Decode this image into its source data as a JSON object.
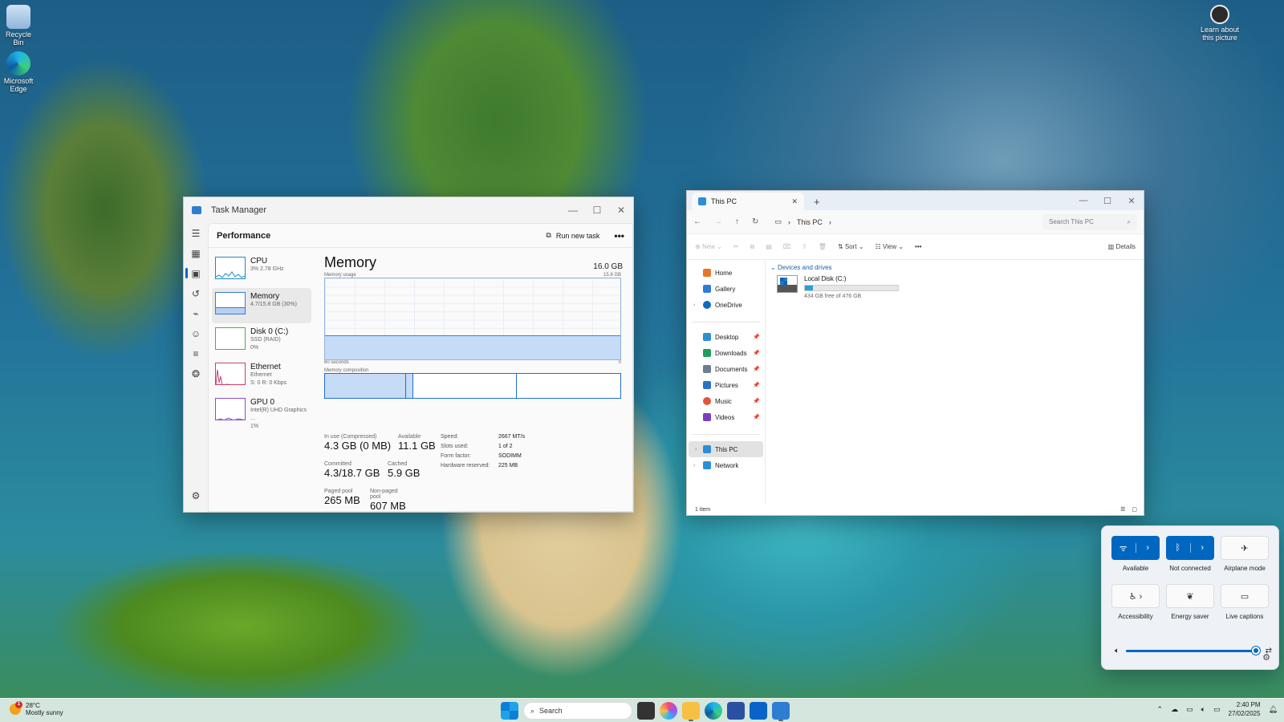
{
  "desktop": {
    "icons": [
      {
        "label": "Recycle Bin",
        "icon": "recycle-bin-icon"
      },
      {
        "label": "Microsoft Edge",
        "icon": "edge-icon"
      }
    ],
    "spotlight_label": "Learn about this picture"
  },
  "task_manager": {
    "title": "Task Manager",
    "window_controls": [
      "—",
      "☐",
      "✕"
    ],
    "page_title": "Performance",
    "run_new_task": "Run new task",
    "more": "•••",
    "rail_icons": [
      "menu-icon",
      "processes-icon",
      "performance-icon",
      "app-history-icon",
      "startup-icon",
      "users-icon",
      "details-icon",
      "services-icon"
    ],
    "resources": [
      {
        "name": "CPU",
        "sub1": "3% 2.78 GHz",
        "sub2": "",
        "sub3": "",
        "color": "#1c8cbc"
      },
      {
        "name": "Memory",
        "sub1": "4.7/15.8 GB (30%)",
        "sub2": "",
        "sub3": "",
        "color": "#7fa9e0"
      },
      {
        "name": "Disk 0 (C:)",
        "sub1": "SSD (RAID)",
        "sub2": "0%",
        "sub3": "",
        "color": "#4caf50"
      },
      {
        "name": "Ethernet",
        "sub1": "Ethernet",
        "sub2": "S: 0 R: 0 Kbps",
        "sub3": "",
        "color": "#c9406b"
      },
      {
        "name": "GPU 0",
        "sub1": "Intel(R) UHD Graphics ...",
        "sub2": "1%",
        "sub3": "",
        "color": "#8a4fc8"
      }
    ],
    "memory": {
      "title": "Memory",
      "total": "16.0 GB",
      "usage_label": "Memory usage",
      "usage_max": "15.8 GB",
      "axis_left": "60 seconds",
      "axis_right": "0",
      "usage_fraction": 0.3,
      "composition_label": "Memory composition",
      "stats": [
        {
          "label": "In use (Compressed)",
          "value": "4.3 GB (0 MB)"
        },
        {
          "label": "Available",
          "value": "11.1 GB"
        },
        {
          "label": "Committed",
          "value": "4.3/18.7 GB"
        },
        {
          "label": "Cached",
          "value": "5.9 GB"
        },
        {
          "label": "Paged pool",
          "value": "265 MB"
        },
        {
          "label": "Non-paged pool",
          "value": "607 MB"
        }
      ],
      "specs": [
        {
          "k": "Speed:",
          "v": "2667 MT/s"
        },
        {
          "k": "Slots used:",
          "v": "1 of 2"
        },
        {
          "k": "Form factor:",
          "v": "SODIMM"
        },
        {
          "k": "Hardware reserved:",
          "v": "225 MB"
        }
      ]
    }
  },
  "explorer": {
    "tab_title": "This PC",
    "close": "✕",
    "new_tab": "+",
    "window_controls": [
      "—",
      "☐",
      "✕"
    ],
    "breadcrumb": "This PC",
    "search_placeholder": "Search This PC",
    "commands": {
      "new": "New",
      "sort": "Sort",
      "view": "View",
      "more": "•••",
      "details": "Details"
    },
    "sidebar": [
      {
        "label": "Home",
        "icon": "home-icon",
        "color": "#e8752b",
        "pinned": false,
        "chevron": false
      },
      {
        "label": "Gallery",
        "icon": "gallery-icon",
        "color": "#2d7dd2",
        "pinned": false,
        "chevron": false
      },
      {
        "label": "OneDrive",
        "icon": "cloud-icon",
        "color": "#0f6cbd",
        "pinned": false,
        "chevron": true
      },
      {
        "label": "Desktop",
        "icon": "desktop-icon",
        "color": "#2a8fd6",
        "pinned": true,
        "chevron": false
      },
      {
        "label": "Downloads",
        "icon": "download-icon",
        "color": "#1e9e5a",
        "pinned": true,
        "chevron": false
      },
      {
        "label": "Documents",
        "icon": "documents-icon",
        "color": "#6b7d8f",
        "pinned": true,
        "chevron": false
      },
      {
        "label": "Pictures",
        "icon": "pictures-icon",
        "color": "#2a72c9",
        "pinned": true,
        "chevron": false
      },
      {
        "label": "Music",
        "icon": "music-icon",
        "color": "#e0533d",
        "pinned": true,
        "chevron": false
      },
      {
        "label": "Videos",
        "icon": "videos-icon",
        "color": "#7a3fbf",
        "pinned": true,
        "chevron": false
      },
      {
        "label": "This PC",
        "icon": "pc-icon",
        "color": "#2a8fd6",
        "pinned": false,
        "chevron": true
      },
      {
        "label": "Network",
        "icon": "network-icon",
        "color": "#2a8fd6",
        "pinned": false,
        "chevron": true
      }
    ],
    "group": "Devices and drives",
    "drive": {
      "name": "Local Disk (C:)",
      "free": "434 GB free of 476 GB",
      "used_fraction": 0.088
    },
    "status": "1 item"
  },
  "quick_settings": {
    "tiles": [
      {
        "label": "Available",
        "icon": "wifi-icon",
        "glyph": "ᯤ",
        "on": true
      },
      {
        "label": "Not connected",
        "icon": "bluetooth-icon",
        "glyph": "ᛒ",
        "on": true
      },
      {
        "label": "Airplane mode",
        "icon": "airplane-icon",
        "glyph": "✈",
        "on": false
      },
      {
        "label": "Accessibility",
        "icon": "accessibility-icon",
        "glyph": "♿ ›",
        "on": false
      },
      {
        "label": "Energy saver",
        "icon": "leaf-icon",
        "glyph": "❦",
        "on": false
      },
      {
        "label": "Live captions",
        "icon": "captions-icon",
        "glyph": "▭",
        "on": false
      }
    ],
    "volume_fraction": 0.98
  },
  "taskbar": {
    "weather": {
      "temp": "28°C",
      "condition": "Mostly sunny",
      "badge": "1"
    },
    "search_label": "Search",
    "time": "2:40 PM",
    "date": "27/02/2025"
  }
}
